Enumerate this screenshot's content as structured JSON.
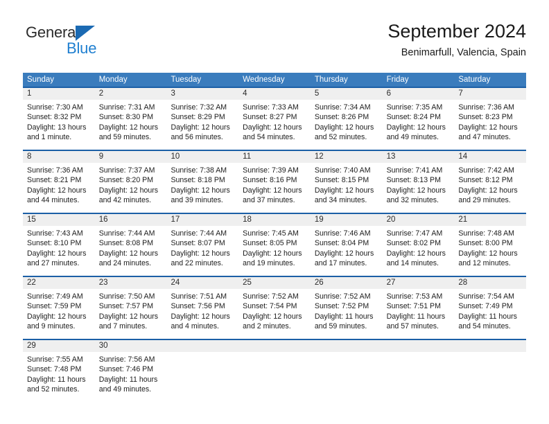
{
  "brand": {
    "name_part1": "General",
    "name_part2": "Blue",
    "triangle_color": "#1b6ab3",
    "blue_color": "#1f7fd0"
  },
  "header": {
    "title": "September 2024",
    "subtitle": "Benimarfull, Valencia, Spain"
  },
  "theme": {
    "header_blue": "#3a7cbd",
    "divider_blue": "#1b5fa6",
    "number_band": "#efefef"
  },
  "weekdays": [
    "Sunday",
    "Monday",
    "Tuesday",
    "Wednesday",
    "Thursday",
    "Friday",
    "Saturday"
  ],
  "weeks": [
    {
      "days": [
        {
          "num": "1",
          "sunrise": "Sunrise: 7:30 AM",
          "sunset": "Sunset: 8:32 PM",
          "daylight1": "Daylight: 13 hours",
          "daylight2": "and 1 minute."
        },
        {
          "num": "2",
          "sunrise": "Sunrise: 7:31 AM",
          "sunset": "Sunset: 8:30 PM",
          "daylight1": "Daylight: 12 hours",
          "daylight2": "and 59 minutes."
        },
        {
          "num": "3",
          "sunrise": "Sunrise: 7:32 AM",
          "sunset": "Sunset: 8:29 PM",
          "daylight1": "Daylight: 12 hours",
          "daylight2": "and 56 minutes."
        },
        {
          "num": "4",
          "sunrise": "Sunrise: 7:33 AM",
          "sunset": "Sunset: 8:27 PM",
          "daylight1": "Daylight: 12 hours",
          "daylight2": "and 54 minutes."
        },
        {
          "num": "5",
          "sunrise": "Sunrise: 7:34 AM",
          "sunset": "Sunset: 8:26 PM",
          "daylight1": "Daylight: 12 hours",
          "daylight2": "and 52 minutes."
        },
        {
          "num": "6",
          "sunrise": "Sunrise: 7:35 AM",
          "sunset": "Sunset: 8:24 PM",
          "daylight1": "Daylight: 12 hours",
          "daylight2": "and 49 minutes."
        },
        {
          "num": "7",
          "sunrise": "Sunrise: 7:36 AM",
          "sunset": "Sunset: 8:23 PM",
          "daylight1": "Daylight: 12 hours",
          "daylight2": "and 47 minutes."
        }
      ]
    },
    {
      "days": [
        {
          "num": "8",
          "sunrise": "Sunrise: 7:36 AM",
          "sunset": "Sunset: 8:21 PM",
          "daylight1": "Daylight: 12 hours",
          "daylight2": "and 44 minutes."
        },
        {
          "num": "9",
          "sunrise": "Sunrise: 7:37 AM",
          "sunset": "Sunset: 8:20 PM",
          "daylight1": "Daylight: 12 hours",
          "daylight2": "and 42 minutes."
        },
        {
          "num": "10",
          "sunrise": "Sunrise: 7:38 AM",
          "sunset": "Sunset: 8:18 PM",
          "daylight1": "Daylight: 12 hours",
          "daylight2": "and 39 minutes."
        },
        {
          "num": "11",
          "sunrise": "Sunrise: 7:39 AM",
          "sunset": "Sunset: 8:16 PM",
          "daylight1": "Daylight: 12 hours",
          "daylight2": "and 37 minutes."
        },
        {
          "num": "12",
          "sunrise": "Sunrise: 7:40 AM",
          "sunset": "Sunset: 8:15 PM",
          "daylight1": "Daylight: 12 hours",
          "daylight2": "and 34 minutes."
        },
        {
          "num": "13",
          "sunrise": "Sunrise: 7:41 AM",
          "sunset": "Sunset: 8:13 PM",
          "daylight1": "Daylight: 12 hours",
          "daylight2": "and 32 minutes."
        },
        {
          "num": "14",
          "sunrise": "Sunrise: 7:42 AM",
          "sunset": "Sunset: 8:12 PM",
          "daylight1": "Daylight: 12 hours",
          "daylight2": "and 29 minutes."
        }
      ]
    },
    {
      "days": [
        {
          "num": "15",
          "sunrise": "Sunrise: 7:43 AM",
          "sunset": "Sunset: 8:10 PM",
          "daylight1": "Daylight: 12 hours",
          "daylight2": "and 27 minutes."
        },
        {
          "num": "16",
          "sunrise": "Sunrise: 7:44 AM",
          "sunset": "Sunset: 8:08 PM",
          "daylight1": "Daylight: 12 hours",
          "daylight2": "and 24 minutes."
        },
        {
          "num": "17",
          "sunrise": "Sunrise: 7:44 AM",
          "sunset": "Sunset: 8:07 PM",
          "daylight1": "Daylight: 12 hours",
          "daylight2": "and 22 minutes."
        },
        {
          "num": "18",
          "sunrise": "Sunrise: 7:45 AM",
          "sunset": "Sunset: 8:05 PM",
          "daylight1": "Daylight: 12 hours",
          "daylight2": "and 19 minutes."
        },
        {
          "num": "19",
          "sunrise": "Sunrise: 7:46 AM",
          "sunset": "Sunset: 8:04 PM",
          "daylight1": "Daylight: 12 hours",
          "daylight2": "and 17 minutes."
        },
        {
          "num": "20",
          "sunrise": "Sunrise: 7:47 AM",
          "sunset": "Sunset: 8:02 PM",
          "daylight1": "Daylight: 12 hours",
          "daylight2": "and 14 minutes."
        },
        {
          "num": "21",
          "sunrise": "Sunrise: 7:48 AM",
          "sunset": "Sunset: 8:00 PM",
          "daylight1": "Daylight: 12 hours",
          "daylight2": "and 12 minutes."
        }
      ]
    },
    {
      "days": [
        {
          "num": "22",
          "sunrise": "Sunrise: 7:49 AM",
          "sunset": "Sunset: 7:59 PM",
          "daylight1": "Daylight: 12 hours",
          "daylight2": "and 9 minutes."
        },
        {
          "num": "23",
          "sunrise": "Sunrise: 7:50 AM",
          "sunset": "Sunset: 7:57 PM",
          "daylight1": "Daylight: 12 hours",
          "daylight2": "and 7 minutes."
        },
        {
          "num": "24",
          "sunrise": "Sunrise: 7:51 AM",
          "sunset": "Sunset: 7:56 PM",
          "daylight1": "Daylight: 12 hours",
          "daylight2": "and 4 minutes."
        },
        {
          "num": "25",
          "sunrise": "Sunrise: 7:52 AM",
          "sunset": "Sunset: 7:54 PM",
          "daylight1": "Daylight: 12 hours",
          "daylight2": "and 2 minutes."
        },
        {
          "num": "26",
          "sunrise": "Sunrise: 7:52 AM",
          "sunset": "Sunset: 7:52 PM",
          "daylight1": "Daylight: 11 hours",
          "daylight2": "and 59 minutes."
        },
        {
          "num": "27",
          "sunrise": "Sunrise: 7:53 AM",
          "sunset": "Sunset: 7:51 PM",
          "daylight1": "Daylight: 11 hours",
          "daylight2": "and 57 minutes."
        },
        {
          "num": "28",
          "sunrise": "Sunrise: 7:54 AM",
          "sunset": "Sunset: 7:49 PM",
          "daylight1": "Daylight: 11 hours",
          "daylight2": "and 54 minutes."
        }
      ]
    },
    {
      "days": [
        {
          "num": "29",
          "sunrise": "Sunrise: 7:55 AM",
          "sunset": "Sunset: 7:48 PM",
          "daylight1": "Daylight: 11 hours",
          "daylight2": "and 52 minutes."
        },
        {
          "num": "30",
          "sunrise": "Sunrise: 7:56 AM",
          "sunset": "Sunset: 7:46 PM",
          "daylight1": "Daylight: 11 hours",
          "daylight2": "and 49 minutes."
        },
        {
          "num": "",
          "sunrise": "",
          "sunset": "",
          "daylight1": "",
          "daylight2": ""
        },
        {
          "num": "",
          "sunrise": "",
          "sunset": "",
          "daylight1": "",
          "daylight2": ""
        },
        {
          "num": "",
          "sunrise": "",
          "sunset": "",
          "daylight1": "",
          "daylight2": ""
        },
        {
          "num": "",
          "sunrise": "",
          "sunset": "",
          "daylight1": "",
          "daylight2": ""
        },
        {
          "num": "",
          "sunrise": "",
          "sunset": "",
          "daylight1": "",
          "daylight2": ""
        }
      ]
    }
  ]
}
